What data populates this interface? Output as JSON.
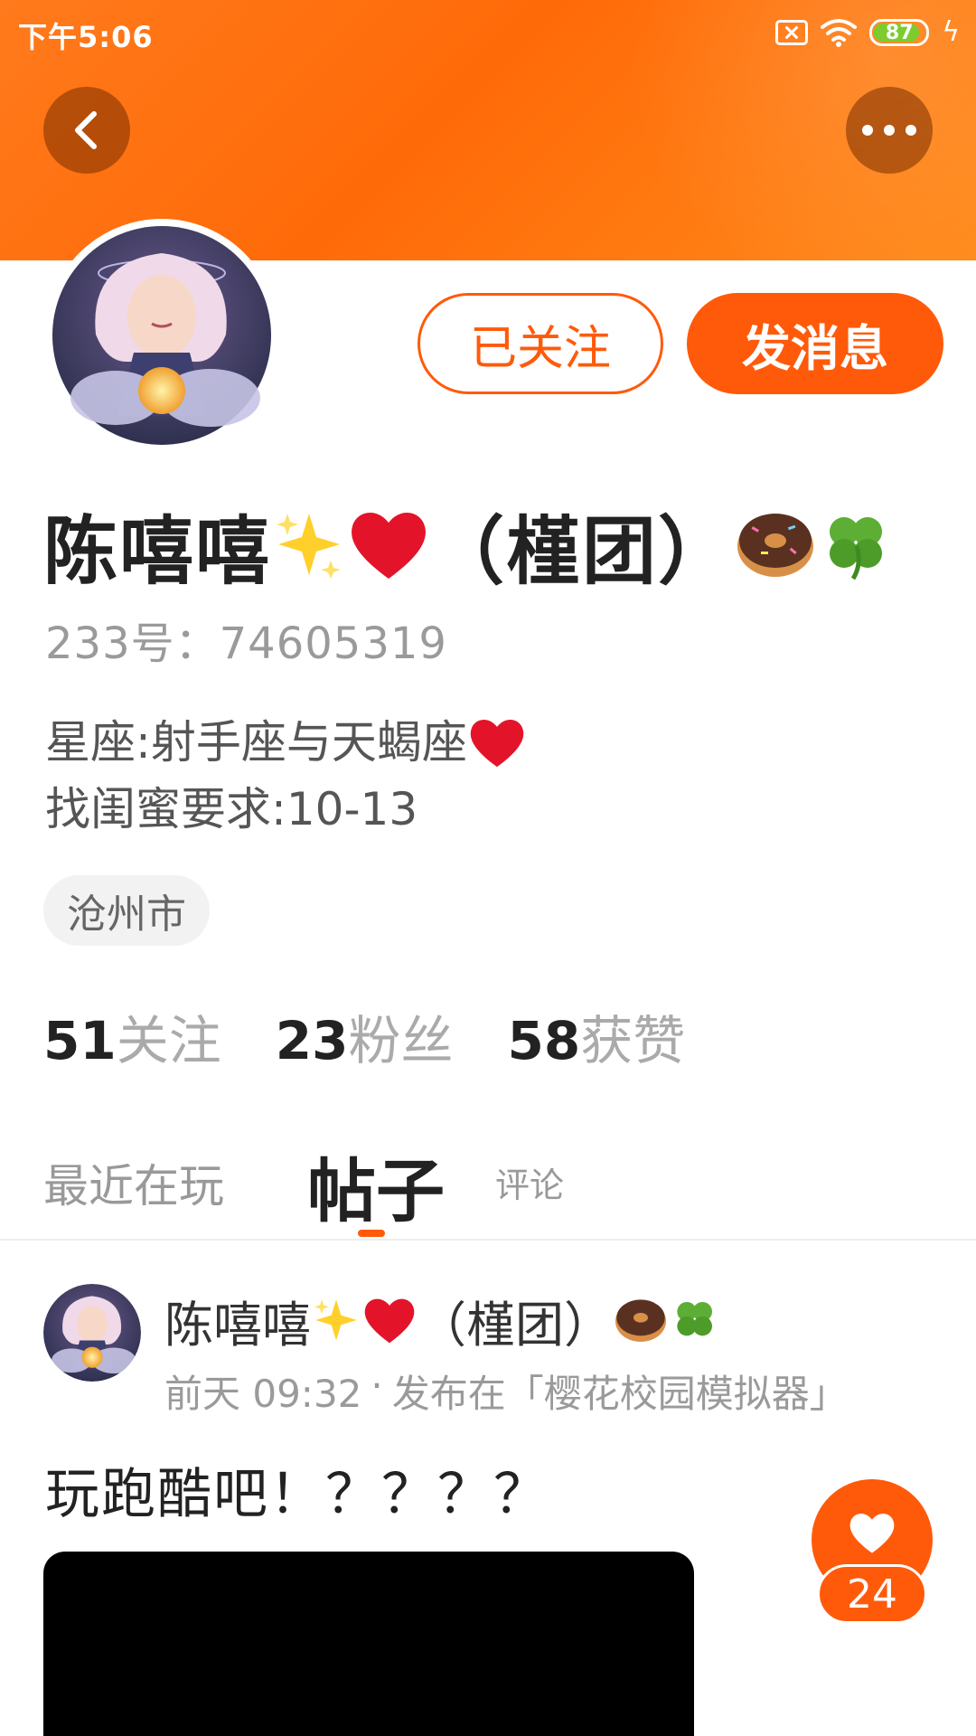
{
  "status_bar": {
    "time": "下午5:06",
    "battery": "87",
    "battery_level": 0.87,
    "icons": [
      "sim-error-icon",
      "wifi-icon",
      "battery-icon",
      "charging-bolt-icon"
    ]
  },
  "header": {
    "back_icon": "chevron-left-icon",
    "more_icon": "more-dots-icon",
    "gradient_colors": [
      "#ff7a1c",
      "#ff6a08",
      "#ff8a1a"
    ]
  },
  "profile": {
    "name": "陈嘻嘻",
    "name_suffix": "（槿团）",
    "name_emojis": [
      "sparkles",
      "red-heart",
      "doughnut",
      "four-leaf-clover"
    ],
    "uid": "233号：74605319",
    "bio_line1": "星座:射手座与天蝎座",
    "bio_line2": "找闺蜜要求:10-13",
    "location": "沧州市"
  },
  "actions": {
    "followed_label": "已关注",
    "message_label": "发消息"
  },
  "stats": {
    "following_count": "51",
    "following_label": "关注",
    "fans_count": "23",
    "fans_label": "粉丝",
    "likes_count": "58",
    "likes_label": "获赞"
  },
  "tabs": {
    "recent": "最近在玩",
    "posts": "帖子",
    "comments": "评论",
    "active": "posts"
  },
  "post": {
    "author": "陈嘻嘻",
    "author_suffix": "（槿团）",
    "time": "前天 09:32",
    "separator": "·",
    "published_in": "发布在「樱花校园模拟器」",
    "title": "玩跑酷吧！？？？？",
    "like_count": "24"
  },
  "colors": {
    "accent": "#ff5a0a",
    "text_primary": "#222222",
    "text_secondary": "#9a9a9a",
    "tag_bg": "#f2f2f2"
  }
}
